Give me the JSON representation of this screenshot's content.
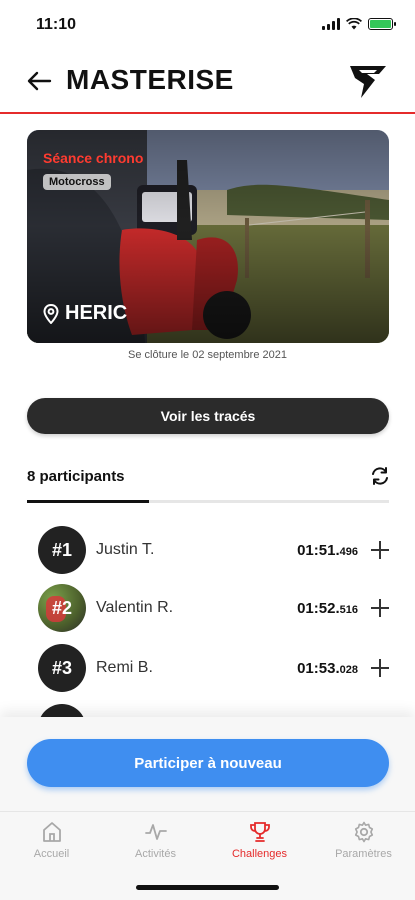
{
  "status": {
    "time": "11:10"
  },
  "header": {
    "title": "MASTERISE"
  },
  "card": {
    "kicker": "Séance chrono",
    "tag": "Motocross",
    "location": "HERIC",
    "closing": "Se clôture le 02 septembre 2021"
  },
  "tracks_button": "Voir les tracés",
  "participants": {
    "count_label": "8 participants",
    "rows": [
      {
        "rank": "#1",
        "name": "Justin T.",
        "time_main": "01:51.",
        "time_ms": "496"
      },
      {
        "rank": "#2",
        "name": "Valentin R.",
        "time_main": "01:52.",
        "time_ms": "516"
      },
      {
        "rank": "#3",
        "name": "Remi B.",
        "time_main": "01:53.",
        "time_ms": "028"
      }
    ]
  },
  "cta": "Participer à nouveau",
  "tabs": [
    {
      "label": "Accueil",
      "icon": "home-icon"
    },
    {
      "label": "Activités",
      "icon": "activity-icon"
    },
    {
      "label": "Challenges",
      "icon": "trophy-icon",
      "active": true
    },
    {
      "label": "Paramètres",
      "icon": "gear-icon"
    }
  ],
  "colors": {
    "accent": "#e52b2b",
    "cta": "#3f8ef0",
    "dark_button": "#2b2b2b"
  }
}
